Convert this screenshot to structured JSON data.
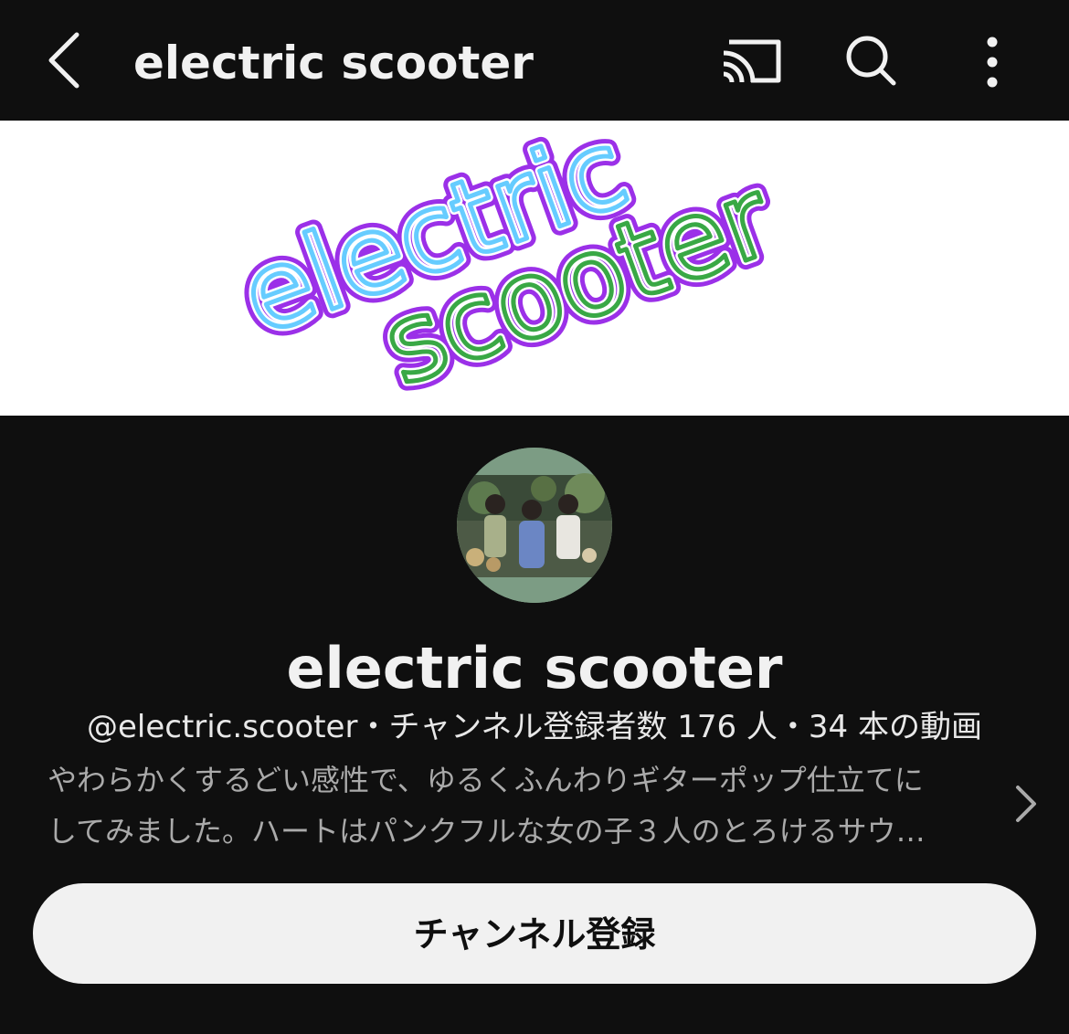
{
  "header": {
    "title": "electric scooter",
    "back_icon": "chevron-left-icon",
    "cast_icon": "cast-icon",
    "search_icon": "search-icon",
    "more_icon": "more-vertical-icon"
  },
  "banner": {
    "line1": "electric",
    "line2": "scooter",
    "colors": {
      "purple": "#9b30e8",
      "cyan": "#66ccff",
      "green": "#39a845"
    }
  },
  "channel": {
    "name": "electric scooter",
    "meta": "@electric.scooter・チャンネル登録者数 176 人・34 本の動画",
    "description_line1": "やわらかくするどい感性で、ゆるくふんわりギターポップ仕立てに",
    "description_line2": "してみました。ハートはパンクフルな女の子３人のとろけるサウ…",
    "expand_icon": "chevron-right-icon"
  },
  "subscribe_button": {
    "label": "チャンネル登録"
  },
  "colors": {
    "background": "#0f0f0f",
    "text": "#f1f1f1",
    "secondary_text": "#aaaaaa",
    "button_bg": "#f1f1f1"
  }
}
